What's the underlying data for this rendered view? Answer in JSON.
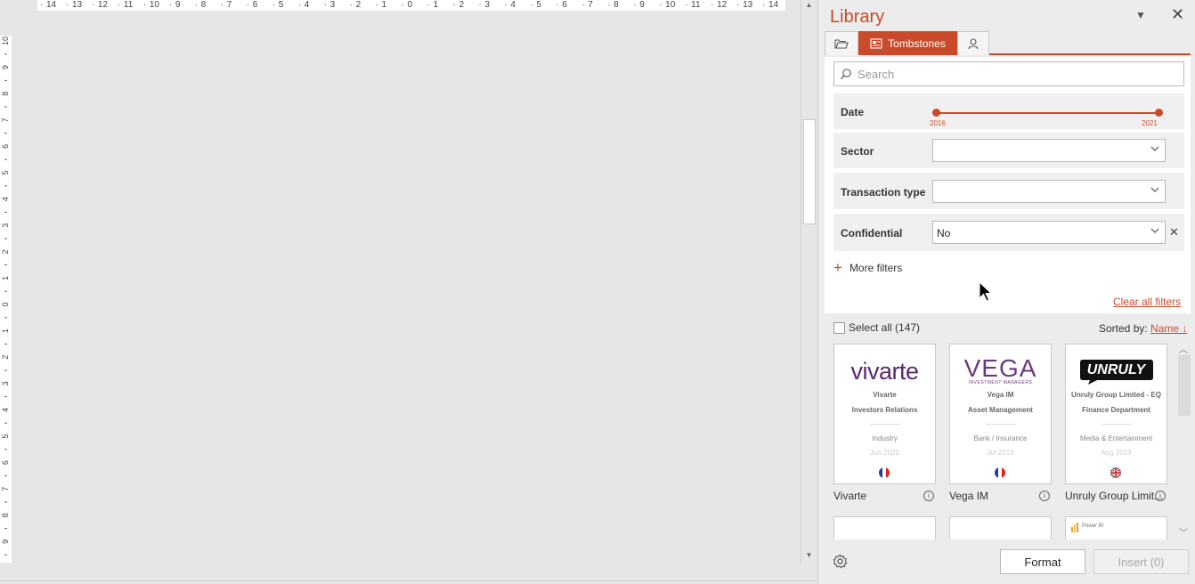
{
  "ruler": {
    "horizontal_ticks": [
      "14",
      "13",
      "12",
      "11",
      "10",
      "9",
      "8",
      "7",
      "6",
      "5",
      "4",
      "3",
      "2",
      "1",
      "0",
      "1",
      "2",
      "3",
      "4",
      "5",
      "6",
      "7",
      "8",
      "9",
      "10",
      "11",
      "12",
      "13",
      "14"
    ],
    "vertical_ticks": [
      "10",
      "9",
      "8",
      "7",
      "6",
      "5",
      "4",
      "3",
      "2",
      "1",
      "0",
      "1",
      "2",
      "3",
      "4",
      "5",
      "6",
      "7",
      "8",
      "9",
      "10"
    ]
  },
  "pane": {
    "title": "Library",
    "tabs": [
      {
        "label": "",
        "icon": "folder-icon"
      },
      {
        "label": "Tombstones",
        "icon": "tombstone-icon",
        "active": true
      },
      {
        "label": "",
        "icon": "person-icon"
      }
    ]
  },
  "filters": {
    "search_placeholder": "Search",
    "date": {
      "label": "Date",
      "from": "2016",
      "to": "2021"
    },
    "sector": {
      "label": "Sector",
      "value": ""
    },
    "transaction_type": {
      "label": "Transaction type",
      "value": ""
    },
    "confidential": {
      "label": "Confidential",
      "value": "No"
    },
    "more_filters": "More filters",
    "clear_all": "Clear all filters"
  },
  "results": {
    "select_all": "Select all (147)",
    "sorted_by_label": "Sorted by:",
    "sorted_by_value": "Name ↓",
    "cards": [
      {
        "logo": "vivarte",
        "name": "Vivarte",
        "dept": "Investors Relations",
        "sector": "Industry",
        "date": "Jun 2020",
        "flag": "fr",
        "caption": "Vivarte"
      },
      {
        "logo": "VEGA",
        "logo_sub": "INVESTMENT MANAGERS",
        "name": "Vega IM",
        "dept": "Asset Management",
        "sector": "Bank / Insurance",
        "date": "Jul 2019",
        "flag": "fr",
        "caption": "Vega IM"
      },
      {
        "logo": "UNRULY",
        "name": "Unruly Group Limited - EQ",
        "dept": "Finance Department",
        "sector": "Media & Entertainment",
        "date": "Aug 2019",
        "flag": "gb",
        "caption": "Unruly Group Limit..."
      }
    ],
    "partial_card_text": "Power BI"
  },
  "footer": {
    "format": "Format",
    "insert": "Insert (0)"
  },
  "colors": {
    "accent": "#c84b2b",
    "vivarte": "#5a2a6e",
    "vega": "#6a3a7e"
  }
}
